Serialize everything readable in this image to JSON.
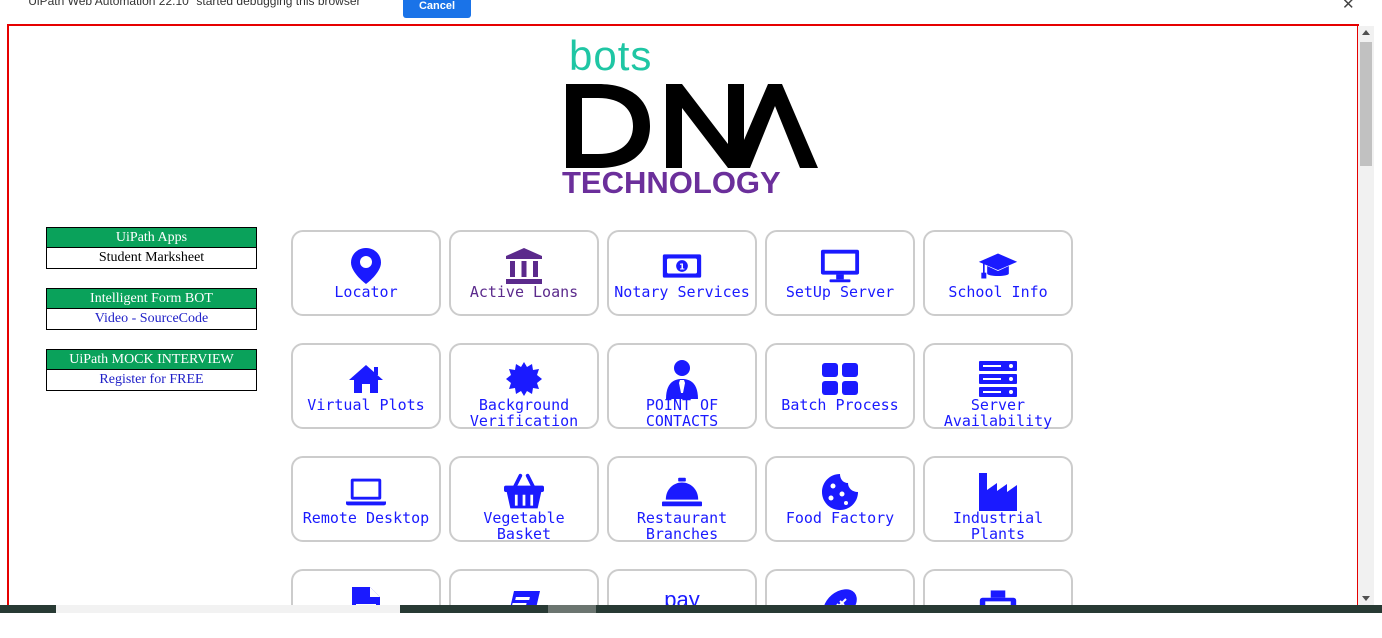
{
  "infobar": {
    "message": "\"UiPath Web Automation 22.10\" started debugging this browser",
    "cancel_label": "Cancel",
    "close_glyph": "✕"
  },
  "logo": {
    "bots": "bots",
    "dna": "DNA",
    "technology": "TECHNOLOGY"
  },
  "colors": {
    "teal": "#1fc6a4",
    "purple": "#6b2f9b",
    "green_header": "#0aa25b",
    "tile_blue": "#1a1aff",
    "frame_red": "#e60000"
  },
  "side_boxes": [
    {
      "heading": "UiPath Apps",
      "body": "Student Marksheet"
    },
    {
      "heading": "Intelligent Form BOT",
      "body": "Video - SourceCode"
    },
    {
      "heading": "UiPath MOCK INTERVIEW",
      "body_prefix": "Register for ",
      "body_link": "FREE"
    }
  ],
  "tiles": [
    {
      "label_1": "Locator",
      "label_2": "",
      "icon": "map-pin-icon"
    },
    {
      "label_1": "Active Loans",
      "label_2": "",
      "icon": "bank-icon"
    },
    {
      "label_1": "Notary Services",
      "label_2": "",
      "icon": "banknote-icon"
    },
    {
      "label_1": "SetUp Server",
      "label_2": "",
      "icon": "monitor-icon"
    },
    {
      "label_1": "School Info",
      "label_2": "",
      "icon": "graduation-cap-icon"
    },
    {
      "label_1": "Virtual Plots",
      "label_2": "",
      "icon": "house-icon"
    },
    {
      "label_1": "Background",
      "label_2": "Verification",
      "icon": "badge-icon"
    },
    {
      "label_1": "POINT OF",
      "label_2": "CONTACTS",
      "icon": "person-tie-icon"
    },
    {
      "label_1": "Batch Process",
      "label_2": "",
      "icon": "grid-icon"
    },
    {
      "label_1": "Server",
      "label_2": "Availability",
      "icon": "server-icon"
    },
    {
      "label_1": "Remote Desktop",
      "label_2": "",
      "icon": "laptop-icon"
    },
    {
      "label_1": "Vegetable",
      "label_2": "Basket",
      "icon": "basket-icon"
    },
    {
      "label_1": "Restaurant",
      "label_2": "Branches",
      "icon": "service-bell-icon"
    },
    {
      "label_1": "Food Factory",
      "label_2": "",
      "icon": "cookie-icon"
    },
    {
      "label_1": "Industrial",
      "label_2": "Plants",
      "icon": "factory-icon"
    },
    {
      "label_1": "",
      "label_2": "",
      "icon": "file-invoice-icon"
    },
    {
      "label_1": "",
      "label_2": "",
      "icon": "book-icon"
    },
    {
      "label_1": "",
      "label_2": "",
      "icon": "pay-icon",
      "icon_text": "pay"
    },
    {
      "label_1": "",
      "label_2": "",
      "icon": "football-icon"
    },
    {
      "label_1": "",
      "label_2": "",
      "icon": "cash-register-icon"
    }
  ]
}
